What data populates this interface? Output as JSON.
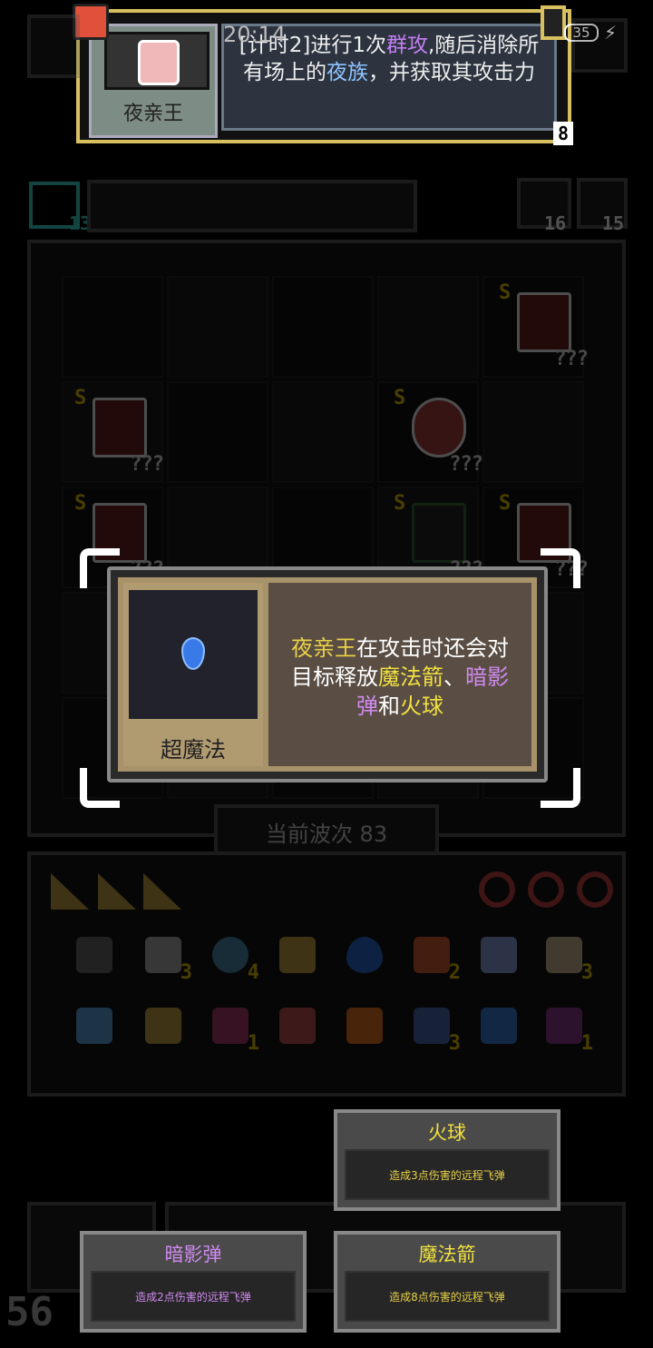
{
  "status_bar": {
    "time": "20:14",
    "battery": "35"
  },
  "hero_card": {
    "name": "夜亲王",
    "desc_part1": "[计时2]进行1次",
    "desc_hl1": "群攻",
    "desc_part2": ",随后消除所有场上的",
    "desc_hl2": "夜族",
    "desc_part3": "，并获取其攻击力",
    "level": "8"
  },
  "top_counters": {
    "left": "13",
    "mid": "16",
    "right": "15"
  },
  "board_units": [
    {
      "s": "S",
      "q": "???"
    },
    {
      "s": "S",
      "q": "???"
    },
    {
      "s": "S",
      "q": "???"
    },
    {
      "s": "S",
      "q": "???"
    },
    {
      "s": "S",
      "q": "???"
    },
    {
      "s": "S",
      "q": "???"
    }
  ],
  "wave": {
    "label": "当前波次",
    "value": "83"
  },
  "inventory_counts": {
    "i2": "3",
    "i3": "4",
    "i6": "2",
    "i8": "3",
    "r2_4": "1",
    "r2_6": "3",
    "r2_8": "1"
  },
  "bottom_number": "56",
  "popup": {
    "title": "超魔法",
    "text_name": "夜亲王",
    "text_a": "在攻击时还会对目标释放",
    "text_b": "魔法箭",
    "text_sep": "、",
    "text_c": "暗影弹",
    "text_and": "和",
    "text_d": "火球"
  },
  "choices": {
    "fireball": {
      "title": "火球",
      "desc": "造成3点伤害的远程飞弹"
    },
    "shadow": {
      "title": "暗影弹",
      "desc": "造成2点伤害的远程飞弹"
    },
    "arrow": {
      "title": "魔法箭",
      "desc": "造成8点伤害的远程飞弹"
    }
  },
  "colors": {
    "gold": "#e8d048",
    "purple": "#c27ef0",
    "blue": "#8fc4ff",
    "popup_frame": "#a8926a"
  }
}
